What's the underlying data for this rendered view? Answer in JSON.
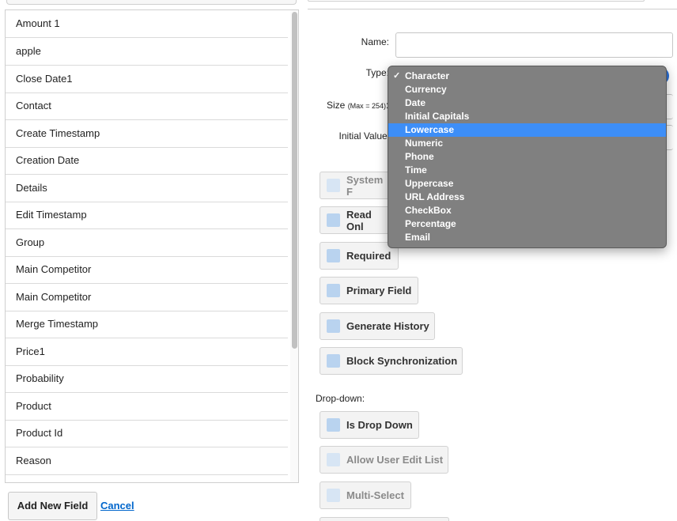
{
  "field_list": {
    "items": [
      "Amount 1",
      "apple",
      "Close Date1",
      "Contact",
      "Create Timestamp",
      "Creation Date",
      "Details",
      "Edit Timestamp",
      "Group",
      "Main Competitor",
      "Main Competitor",
      "Merge Timestamp",
      "Price1",
      "Probability",
      "Product",
      "Product Id",
      "Reason"
    ]
  },
  "actions": {
    "add_label": "Add New Field",
    "cancel_label": "Cancel"
  },
  "form": {
    "name_label": "Name:",
    "name_value": "",
    "type_label": "Type:",
    "size_label": "Size",
    "size_hint": "(Max = 254)",
    "size_colon": ":",
    "initial_value_label": "Initial Value:",
    "checkboxes": {
      "system_field": "System F",
      "read_only": "Read Onl",
      "required": "Required",
      "primary_field": "Primary Field",
      "generate_history": "Generate History",
      "block_sync": "Block Synchronization"
    },
    "dropdown_section_label": "Drop-down:",
    "dropdown_checkboxes": {
      "is_drop_down": "Is Drop Down",
      "allow_user_edit": "Allow User Edit List",
      "multi_select": "Multi-Select"
    }
  },
  "type_dropdown": {
    "checked_option": "Character",
    "highlighted_option": "Lowercase",
    "check_glyph": "✓",
    "options": [
      "Character",
      "Currency",
      "Date",
      "Initial Capitals",
      "Lowercase",
      "Numeric",
      "Phone",
      "Time",
      "Uppercase",
      "URL Address",
      "CheckBox",
      "Percentage",
      "Email"
    ]
  },
  "colors": {
    "link": "#0066cc",
    "highlight": "#3d8ef7",
    "popup_bg": "#808080",
    "checkbox": "#b9d3ef"
  }
}
